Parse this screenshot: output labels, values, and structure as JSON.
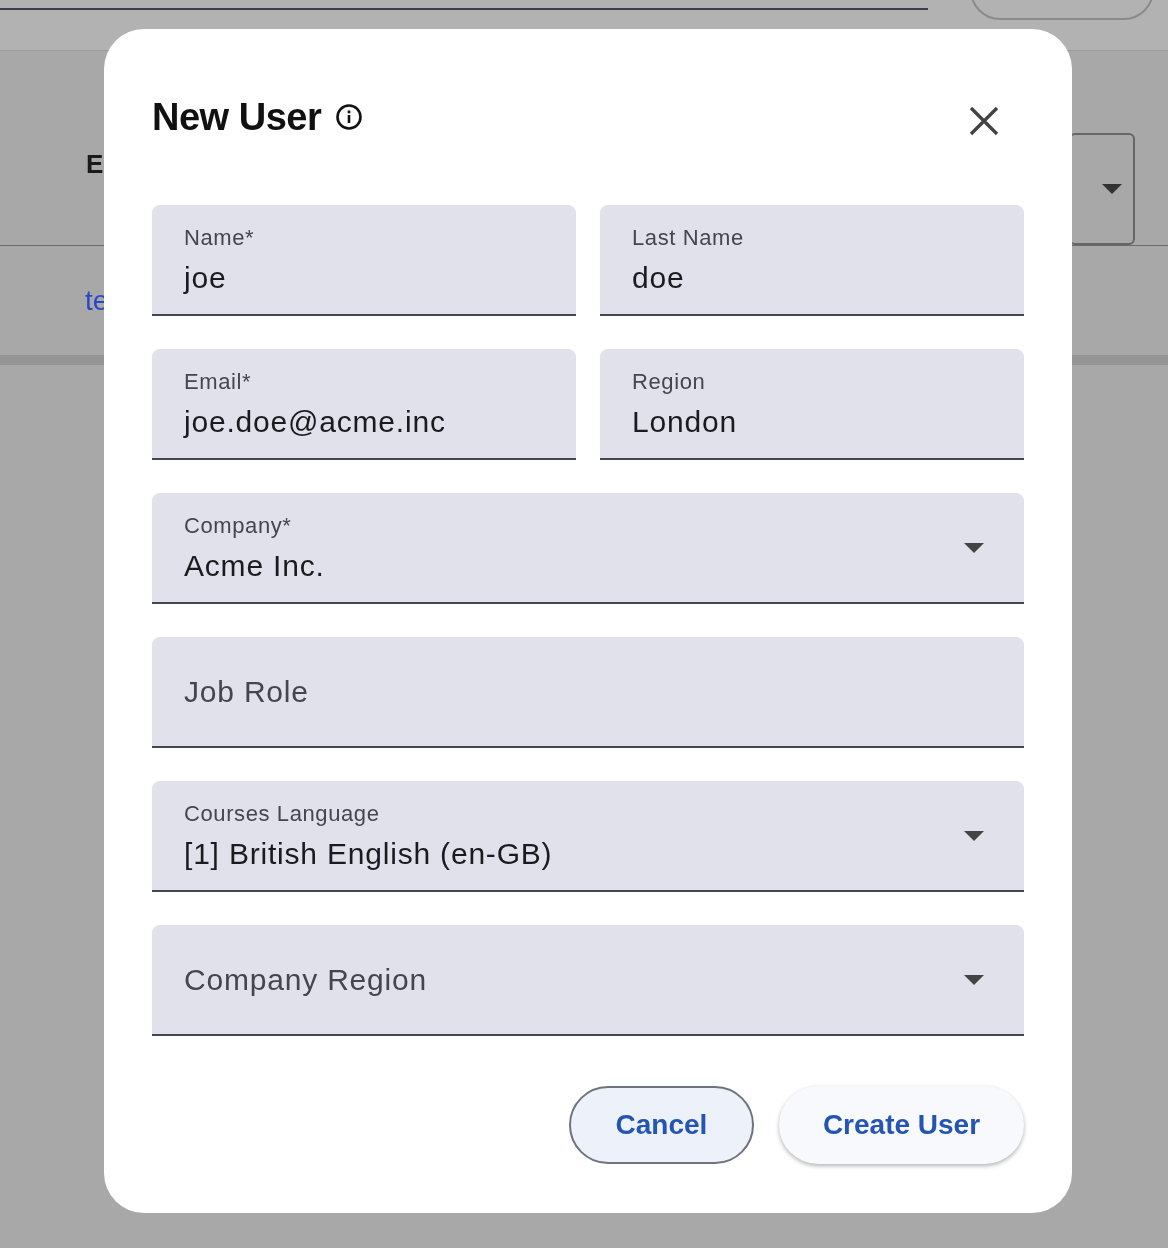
{
  "background": {
    "heading": "E",
    "link": "te"
  },
  "dialog": {
    "title": "New User",
    "rows": [
      [
        {
          "kind": "text",
          "label": "Name*",
          "value": "joe"
        },
        {
          "kind": "text",
          "label": "Last Name",
          "value": "doe"
        }
      ],
      [
        {
          "kind": "text",
          "label": "Email*",
          "value": "joe.doe@acme.inc"
        },
        {
          "kind": "text",
          "label": "Region",
          "value": "London"
        }
      ],
      [
        {
          "kind": "select",
          "label": "Company*",
          "value": "Acme Inc."
        }
      ],
      [
        {
          "kind": "text",
          "label": "Job Role"
        }
      ],
      [
        {
          "kind": "select",
          "label": "Courses Language",
          "value": "[1] British English (en-GB)"
        }
      ],
      [
        {
          "kind": "select",
          "label": "Company Region"
        }
      ]
    ],
    "buttons": [
      {
        "kind": "outlined",
        "label": "Cancel"
      },
      {
        "kind": "elevated",
        "label": "Create User"
      }
    ]
  }
}
